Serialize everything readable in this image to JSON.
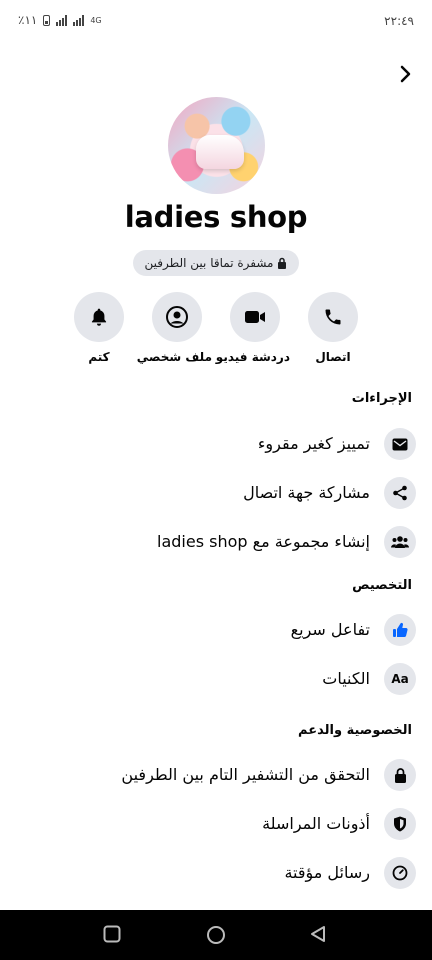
{
  "status_bar": {
    "time": "٢٢:٤٩",
    "battery": "٪١١",
    "network": "4G"
  },
  "profile": {
    "name": "ladies shop",
    "e2e_label": "مشفرة تماقا بين الطرفين"
  },
  "actions": [
    {
      "label": "اتصال",
      "icon": "phone-icon"
    },
    {
      "label": "دردشة فيديو",
      "icon": "video-camera-icon"
    },
    {
      "label": "ملف شخصي",
      "icon": "profile-icon"
    },
    {
      "label": "كتم",
      "icon": "bell-icon"
    }
  ],
  "sections": {
    "actions_title": "الإجراءات",
    "actions_items": [
      {
        "label": "تمييز كغير مقروء",
        "icon": "envelope-icon"
      },
      {
        "label": "مشاركة جهة اتصال",
        "icon": "share-icon"
      },
      {
        "label": "إنشاء مجموعة مع ladies shop",
        "icon": "group-icon"
      }
    ],
    "customization_title": "التخصيص",
    "customization_items": [
      {
        "label": "تفاعل سريع",
        "icon": "thumbs-up-icon"
      },
      {
        "label": "الكنيات",
        "icon": "nickname-icon",
        "glyph": "Aa"
      }
    ],
    "privacy_title": "الخصوصية والدعم",
    "privacy_items": [
      {
        "label": "التحقق من التشفير التام بين الطرفين",
        "icon": "lock-icon"
      },
      {
        "label": "أذونات المراسلة",
        "icon": "shield-icon"
      },
      {
        "label": "رسائل مؤقتة",
        "icon": "timer-icon"
      }
    ]
  },
  "colors": {
    "accent": "#0866ff",
    "chip_bg": "#e4e6eb"
  }
}
